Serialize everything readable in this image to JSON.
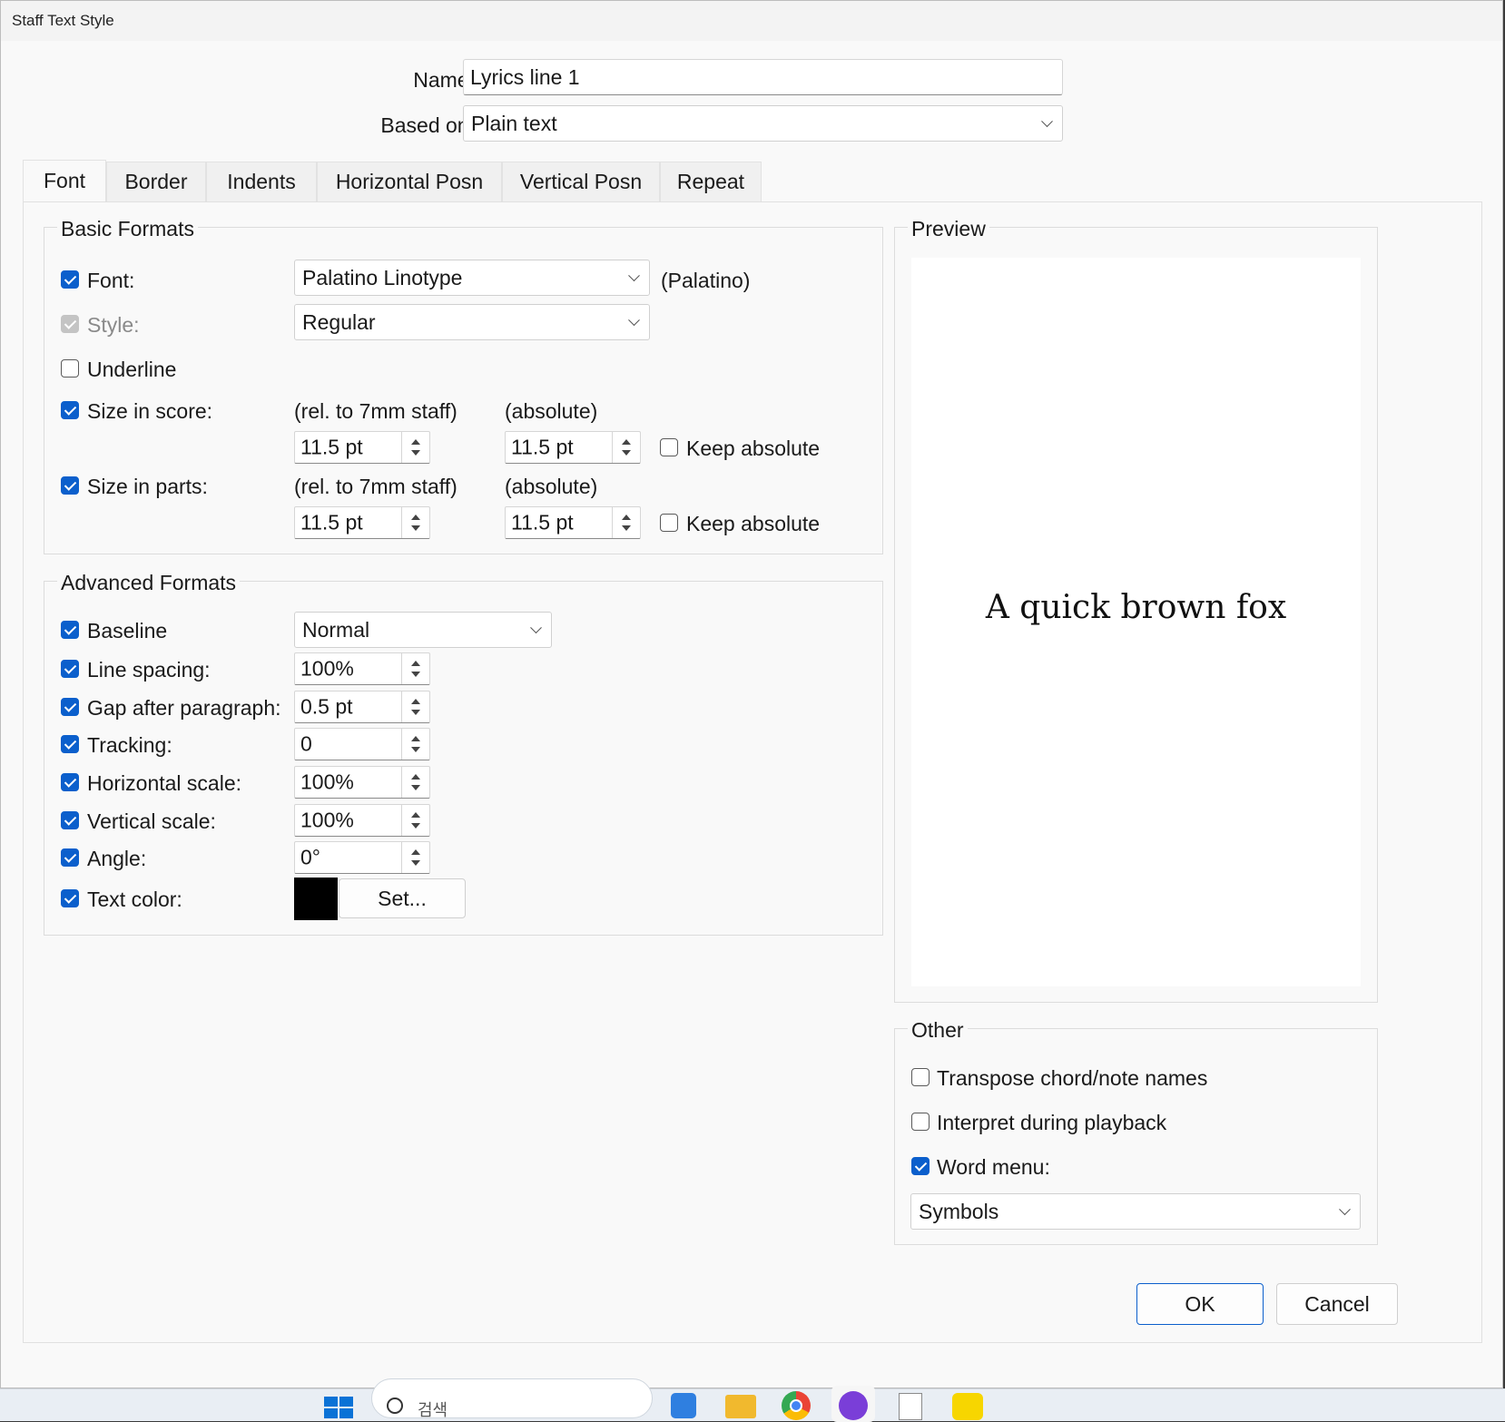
{
  "window": {
    "title": "Staff Text Style"
  },
  "header": {
    "name_label": "Name:",
    "name_value": "Lyrics line 1",
    "based_on_label": "Based on:",
    "based_on_value": "Plain text"
  },
  "tabs": [
    {
      "label": "Font",
      "active": true
    },
    {
      "label": "Border"
    },
    {
      "label": "Indents"
    },
    {
      "label": "Horizontal Posn"
    },
    {
      "label": "Vertical Posn"
    },
    {
      "label": "Repeat"
    }
  ],
  "basic": {
    "title": "Basic Formats",
    "font_label": "Font:",
    "font_value": "Palatino Linotype",
    "font_alias": "(Palatino)",
    "style_label": "Style:",
    "style_value": "Regular",
    "underline_label": "Underline",
    "size_score_label": "Size in score:",
    "size_parts_label": "Size in parts:",
    "rel_label": "(rel. to 7mm staff)",
    "abs_label": "(absolute)",
    "score_rel": "11.5 pt",
    "score_abs": "11.5 pt",
    "parts_rel": "11.5 pt",
    "parts_abs": "11.5 pt",
    "keep_absolute_label": "Keep absolute"
  },
  "advanced": {
    "title": "Advanced Formats",
    "baseline_label": "Baseline",
    "baseline_value": "Normal",
    "line_spacing_label": "Line spacing:",
    "line_spacing_value": "100%",
    "gap_label": "Gap after paragraph:",
    "gap_value": "0.5 pt",
    "tracking_label": "Tracking:",
    "tracking_value": "0",
    "hscale_label": "Horizontal scale:",
    "hscale_value": "100%",
    "vscale_label": "Vertical scale:",
    "vscale_value": "100%",
    "angle_label": "Angle:",
    "angle_value": "0°",
    "color_label": "Text color:",
    "color_value": "#000000",
    "set_label": "Set..."
  },
  "preview": {
    "title": "Preview",
    "sample": "A quick brown fox"
  },
  "other": {
    "title": "Other",
    "transpose_label": "Transpose chord/note names",
    "interpret_label": "Interpret during playback",
    "word_menu_label": "Word menu:",
    "word_menu_value": "Symbols"
  },
  "buttons": {
    "ok": "OK",
    "cancel": "Cancel"
  },
  "taskbar": {
    "search_placeholder": "검색"
  },
  "colors": {
    "accent": "#0b5fcc"
  }
}
